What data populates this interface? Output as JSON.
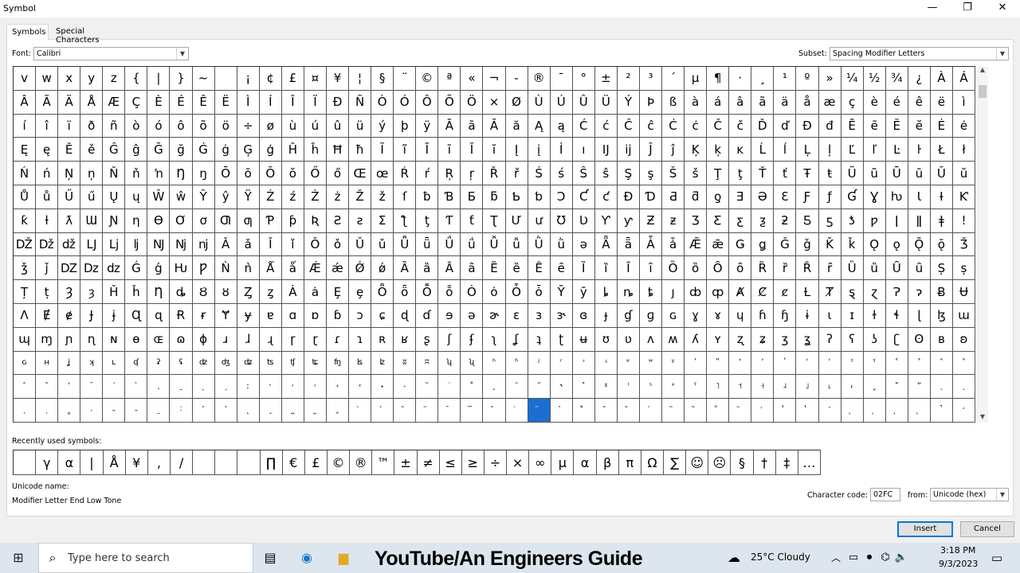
{
  "window": {
    "title": "Symbol",
    "controls": {
      "minimize": "—",
      "restore": "❐",
      "close": "✕"
    }
  },
  "tabs": [
    "Symbols",
    "Special Characters"
  ],
  "font": {
    "label": "Font:",
    "value": "Calibri"
  },
  "subset": {
    "label": "Subset:",
    "value": "Spacing Modifier Letters"
  },
  "grid": {
    "columns": 43,
    "selected_index": 625,
    "rows": [
      [
        "v",
        "w",
        "x",
        "y",
        "z",
        "{",
        "|",
        "}",
        "~",
        " ",
        "¡",
        "¢",
        "£",
        "¤",
        "¥",
        "¦",
        "§",
        "¨",
        "©",
        "ª",
        "«",
        "¬",
        "-",
        "®",
        "¯",
        "°",
        "±",
        "²",
        "³",
        "´",
        "µ",
        "¶",
        "·",
        "¸",
        "¹",
        "º",
        "»",
        "¼",
        "½",
        "¾",
        "¿",
        "À",
        "Á"
      ],
      [
        "Â",
        "Ã",
        "Ä",
        "Å",
        "Æ",
        "Ç",
        "È",
        "É",
        "Ê",
        "Ë",
        "Ì",
        "Í",
        "Î",
        "Ï",
        "Ð",
        "Ñ",
        "Ò",
        "Ó",
        "Ô",
        "Õ",
        "Ö",
        "×",
        "Ø",
        "Ù",
        "Ú",
        "Û",
        "Ü",
        "Ý",
        "Þ",
        "ß",
        "à",
        "á",
        "â",
        "ã",
        "ä",
        "å",
        "æ",
        "ç",
        "è",
        "é",
        "ê",
        "ë",
        "ì"
      ],
      [
        "í",
        "î",
        "ï",
        "ð",
        "ñ",
        "ò",
        "ó",
        "ô",
        "õ",
        "ö",
        "÷",
        "ø",
        "ù",
        "ú",
        "û",
        "ü",
        "ý",
        "þ",
        "ÿ",
        "Ā",
        "ā",
        "Ă",
        "ă",
        "Ą",
        "ą",
        "Ć",
        "ć",
        "Ĉ",
        "ĉ",
        "Ċ",
        "ċ",
        "Č",
        "č",
        "Ď",
        "ď",
        "Đ",
        "đ",
        "Ē",
        "ē",
        "Ĕ",
        "ĕ",
        "Ė",
        "ė"
      ],
      [
        "Ę",
        "ę",
        "Ě",
        "ě",
        "Ĝ",
        "ĝ",
        "Ğ",
        "ğ",
        "Ġ",
        "ġ",
        "Ģ",
        "ģ",
        "Ĥ",
        "ĥ",
        "Ħ",
        "ħ",
        "Ĩ",
        "ĩ",
        "Ī",
        "ī",
        "Ĭ",
        "ĭ",
        "Į",
        "į",
        "İ",
        "ı",
        "Ĳ",
        "ĳ",
        "Ĵ",
        "ĵ",
        "Ķ",
        "ķ",
        "ĸ",
        "Ĺ",
        "ĺ",
        "Ļ",
        "ļ",
        "Ľ",
        "ľ",
        "Ŀ",
        "ŀ",
        "Ł",
        "ł"
      ],
      [
        "Ń",
        "ń",
        "Ņ",
        "ņ",
        "Ň",
        "ň",
        "ŉ",
        "Ŋ",
        "ŋ",
        "Ō",
        "ō",
        "Ŏ",
        "ŏ",
        "Ő",
        "ő",
        "Œ",
        "œ",
        "Ŕ",
        "ŕ",
        "Ŗ",
        "ŗ",
        "Ř",
        "ř",
        "Ś",
        "ś",
        "Ŝ",
        "ŝ",
        "Ş",
        "ş",
        "Š",
        "š",
        "Ţ",
        "ţ",
        "Ť",
        "ť",
        "Ŧ",
        "ŧ",
        "Ũ",
        "ũ",
        "Ū",
        "ū",
        "Ŭ",
        "ŭ"
      ],
      [
        "Ů",
        "ů",
        "Ű",
        "ű",
        "Ų",
        "ų",
        "Ŵ",
        "ŵ",
        "Ŷ",
        "ŷ",
        "Ÿ",
        "Ź",
        "ź",
        "Ż",
        "ż",
        "Ž",
        "ž",
        "ſ",
        "ƀ",
        "Ɓ",
        "Ƃ",
        "ƃ",
        "Ƅ",
        "ƅ",
        "Ɔ",
        "Ƈ",
        "ƈ",
        "Ɖ",
        "Ɗ",
        "Ƌ",
        "ƌ",
        "ƍ",
        "Ǝ",
        "Ə",
        "Ɛ",
        "Ƒ",
        "ƒ",
        "Ɠ",
        "Ɣ",
        "ƕ",
        "Ɩ",
        "Ɨ",
        "Ƙ"
      ],
      [
        "ƙ",
        "ƚ",
        "ƛ",
        "Ɯ",
        "Ɲ",
        "ƞ",
        "Ɵ",
        "Ơ",
        "ơ",
        "Ƣ",
        "ƣ",
        "Ƥ",
        "ƥ",
        "Ʀ",
        "Ƨ",
        "ƨ",
        "Ʃ",
        "ƪ",
        "ƫ",
        "Ƭ",
        "ƭ",
        "Ʈ",
        "Ư",
        "ư",
        "Ʊ",
        "Ʋ",
        "Ƴ",
        "ƴ",
        "Ƶ",
        "ƶ",
        "Ʒ",
        "Ƹ",
        "ƹ",
        "ƺ",
        "ƻ",
        "Ƽ",
        "ƽ",
        "ƾ",
        "ƿ",
        "ǀ",
        "ǁ",
        "ǂ",
        "ǃ"
      ],
      [
        "Ǆ",
        "ǅ",
        "ǆ",
        "Ǉ",
        "ǈ",
        "ǉ",
        "Ǌ",
        "ǋ",
        "ǌ",
        "Ǎ",
        "ǎ",
        "Ǐ",
        "ǐ",
        "Ǒ",
        "ǒ",
        "Ǔ",
        "ǔ",
        "Ǖ",
        "ǖ",
        "Ǘ",
        "ǘ",
        "Ǚ",
        "ǚ",
        "Ǜ",
        "ǜ",
        "ǝ",
        "Ǟ",
        "ǟ",
        "Ǡ",
        "ǡ",
        "Ǣ",
        "ǣ",
        "Ǥ",
        "ǥ",
        "Ǧ",
        "ǧ",
        "Ǩ",
        "ǩ",
        "Ǫ",
        "ǫ",
        "Ǭ",
        "ǭ",
        "Ǯ"
      ],
      [
        "ǯ",
        "ǰ",
        "Ǳ",
        "ǲ",
        "ǳ",
        "Ǵ",
        "ǵ",
        "Ƕ",
        "Ƿ",
        "Ǹ",
        "ǹ",
        "Ǻ",
        "ǻ",
        "Ǽ",
        "ǽ",
        "Ǿ",
        "ǿ",
        "Ȁ",
        "ȁ",
        "Ȃ",
        "ȃ",
        "Ȅ",
        "ȅ",
        "Ȇ",
        "ȇ",
        "Ȉ",
        "ȉ",
        "Ȋ",
        "ȋ",
        "Ȍ",
        "ȍ",
        "Ȏ",
        "ȏ",
        "Ȑ",
        "ȑ",
        "Ȓ",
        "ȓ",
        "Ȕ",
        "ȕ",
        "Ȗ",
        "ȗ",
        "Ș",
        "ș"
      ],
      [
        "Ț",
        "ț",
        "Ȝ",
        "ȝ",
        "Ȟ",
        "ȟ",
        "Ƞ",
        "ȡ",
        "Ȣ",
        "ȣ",
        "Ȥ",
        "ȥ",
        "Ȧ",
        "ȧ",
        "Ȩ",
        "ȩ",
        "Ȫ",
        "ȫ",
        "Ȭ",
        "ȭ",
        "Ȯ",
        "ȯ",
        "Ȱ",
        "ȱ",
        "Ȳ",
        "ȳ",
        "ȴ",
        "ȵ",
        "ȶ",
        "ȷ",
        "ȸ",
        "ȹ",
        "Ⱥ",
        "Ȼ",
        "ȼ",
        "Ƚ",
        "Ⱦ",
        "ȿ",
        "ɀ",
        "Ɂ",
        "ɂ",
        "Ƀ",
        "Ʉ"
      ],
      [
        "Ʌ",
        "Ɇ",
        "ɇ",
        "Ɉ",
        "ɉ",
        "Ɋ",
        "ɋ",
        "Ɍ",
        "ɍ",
        "Ɏ",
        "ɏ",
        "ɐ",
        "ɑ",
        "ɒ",
        "ɓ",
        "ɔ",
        "ɕ",
        "ɖ",
        "ɗ",
        "ɘ",
        "ə",
        "ɚ",
        "ɛ",
        "ɜ",
        "ɝ",
        "ɞ",
        "ɟ",
        "ɠ",
        "ɡ",
        "ɢ",
        "ɣ",
        "ɤ",
        "ɥ",
        "ɦ",
        "ɧ",
        "ɨ",
        "ɩ",
        "ɪ",
        "ɫ",
        "ɬ",
        "ɭ",
        "ɮ",
        "ɯ"
      ],
      [
        "ɰ",
        "ɱ",
        "ɲ",
        "ɳ",
        "ɴ",
        "ɵ",
        "ɶ",
        "ɷ",
        "ɸ",
        "ɹ",
        "ɺ",
        "ɻ",
        "ɼ",
        "ɽ",
        "ɾ",
        "ɿ",
        "ʀ",
        "ʁ",
        "ʂ",
        "ʃ",
        "ʄ",
        "ʅ",
        "ʆ",
        "ʇ",
        "ʈ",
        "ʉ",
        "ʊ",
        "ʋ",
        "ʌ",
        "ʍ",
        "ʎ",
        "ʏ",
        "ʐ",
        "ʑ",
        "ʒ",
        "ʓ",
        "ʔ",
        "ʕ",
        "ʖ",
        "ʗ",
        "ʘ",
        "ʙ",
        "ʚ"
      ],
      [
        "ɢ",
        "ʜ",
        "ʝ",
        "ʞ",
        "ʟ",
        "ʠ",
        "ʡ",
        "ʢ",
        "ʣ",
        "ʤ",
        "ʥ",
        "ʦ",
        "ʧ",
        "ʨ",
        "ʩ",
        "ʪ",
        "ʫ",
        "ʬ",
        "ʭ",
        "ʮ",
        "ʯ",
        "ʰ",
        "ʱ",
        "ʲ",
        "ʳ",
        "ʴ",
        "ʵ",
        "ʶ",
        "ʷ",
        "ʸ",
        "ʹ",
        "ʺ",
        "ʻ",
        "ʼ",
        "ʽ",
        "ʾ",
        "ʿ",
        "ˀ",
        "ˁ",
        "˂",
        "˃",
        "˄",
        "˅"
      ],
      [
        "ˆ",
        "ˇ",
        "ˈ",
        "ˉ",
        "ˊ",
        "ˋ",
        "ˌ",
        "ˍ",
        "ˎ",
        "ˏ",
        "ː",
        "ˑ",
        "˒",
        "˓",
        "˔",
        "˕",
        "˖",
        "˗",
        "˘",
        "˙",
        "˚",
        "˛",
        "˜",
        "˝",
        "˞",
        "˟",
        "ˠ",
        "ˡ",
        "ˢ",
        "ˣ",
        "ˤ",
        "˥",
        "˦",
        "˧",
        "˨",
        "˩",
        "˪",
        "˫",
        "ˬ",
        "˭",
        "ˮ",
        "˯",
        "˰"
      ],
      [
        "˱",
        "˲",
        "˳",
        "˴",
        "˵",
        "˶",
        "˷",
        "˸",
        "˹",
        "˺",
        "˻",
        "˼",
        "˽",
        "˾",
        "˿",
        "̀",
        "́",
        "̂",
        "̃",
        "̄",
        "̅",
        "̆",
        "̇",
        "̈",
        "̉",
        "̊",
        "̋",
        "̌",
        "̍",
        "̎",
        "̏",
        "̐",
        "̑",
        "̒",
        "̓",
        "̔",
        "̕",
        "̖",
        "̗",
        "̘",
        "̙",
        "̚",
        "̛"
      ]
    ]
  },
  "recently_used": {
    "label": "Recently used symbols:",
    "symbols": [
      " ",
      "γ",
      "α",
      "|",
      "Å",
      "¥",
      ",",
      "/",
      " ",
      " ",
      " ",
      "∏",
      "€",
      "£",
      "©",
      "®",
      "™",
      "±",
      "≠",
      "≤",
      "≥",
      "÷",
      "×",
      "∞",
      "µ",
      "α",
      "β",
      "π",
      "Ω",
      "∑",
      "☺",
      "☹",
      "§",
      "†",
      "‡",
      "…"
    ]
  },
  "unicode": {
    "label": "Unicode name:",
    "name": "Modifier Letter End Low Tone"
  },
  "character_code": {
    "label": "Character code:",
    "value": "02FC",
    "from_label": "from:",
    "from_value": "Unicode (hex)"
  },
  "buttons": {
    "insert": "Insert",
    "cancel": "Cancel"
  },
  "taskbar": {
    "search_placeholder": "Type here to search",
    "watermark": "YouTube/An Engineers Guide",
    "weather": "25°C  Cloudy",
    "time": "3:18 PM",
    "date": "9/3/2023"
  }
}
